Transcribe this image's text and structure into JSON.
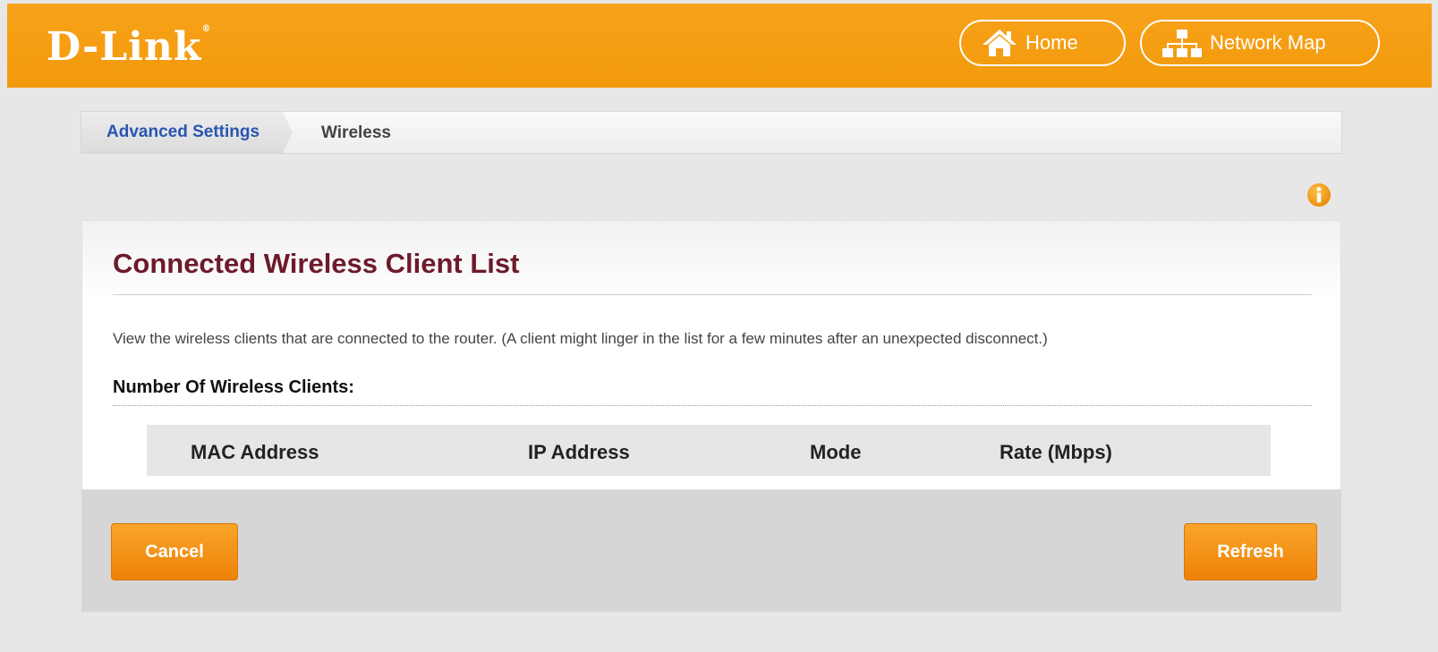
{
  "header": {
    "logo_text": "D-Link",
    "logo_mark": "®",
    "nav": [
      {
        "label": "Home",
        "icon": "home-icon"
      },
      {
        "label": "Network Map",
        "icon": "network-map-icon"
      }
    ]
  },
  "breadcrumb": {
    "parent": "Advanced Settings",
    "current": "Wireless"
  },
  "info_icon": "info-icon",
  "main": {
    "title": "Connected Wireless Client List",
    "description": "View the wireless clients that are connected to the router. (A client might linger in the list for a few minutes after an unexpected disconnect.)",
    "count_label": "Number Of Wireless Clients:",
    "table": {
      "columns": [
        "MAC Address",
        "IP Address",
        "Mode",
        "Rate (Mbps)"
      ],
      "rows": []
    }
  },
  "footer": {
    "cancel_label": "Cancel",
    "refresh_label": "Refresh"
  },
  "colors": {
    "brand_orange": "#f39a0c",
    "title_color": "#6d1a2a",
    "link_blue": "#2a55b0"
  }
}
